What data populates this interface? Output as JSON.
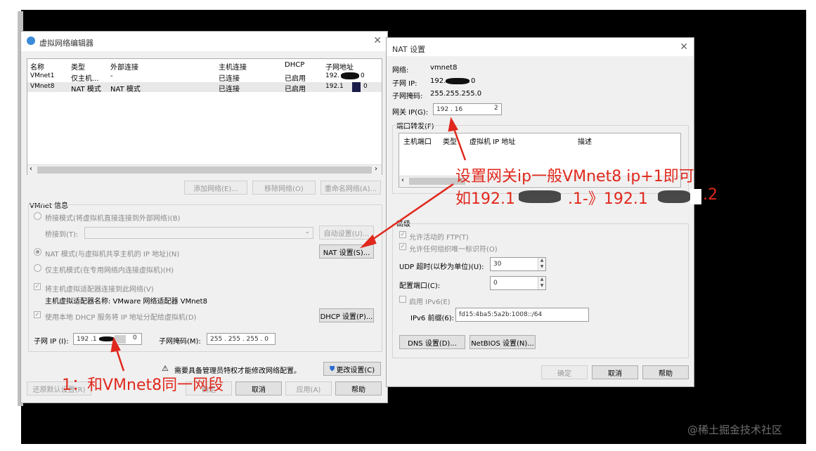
{
  "vne": {
    "title": "虚拟网络编辑器",
    "columns": [
      "名称",
      "类型",
      "外部连接",
      "主机连接",
      "DHCP",
      "子网地址"
    ],
    "rows": [
      {
        "name": "VMnet1",
        "type": "仅主机...",
        "ext": "-",
        "host": "已连接",
        "dhcp": "已启用",
        "subnet": "192."
      },
      {
        "name": "VMnet8",
        "type": "NAT 模式",
        "ext": "NAT 模式",
        "host": "已连接",
        "dhcp": "已启用",
        "subnet": "192.1"
      }
    ],
    "subnet_suffix_1": "0",
    "subnet_suffix_2": "0",
    "add_network": "添加网络(E)...",
    "remove_network": "移除网络(O)",
    "rename_network": "重命名网络(A)...",
    "info_label": "VMnet 信息",
    "bridge_mode": "桥接模式(将虚拟机直接连接到外部网络)(B)",
    "bridge_to": "桥接到(T):",
    "auto_settings": "自动设置(U)...",
    "nat_mode": "NAT 模式(与虚拟机共享主机的 IP 地址)(N)",
    "nat_settings": "NAT 设置(S)...",
    "host_only": "仅主机模式(在专用网络内连接虚拟机)(H)",
    "connect_adapter": "将主机虚拟适配器连接到此网络(V)",
    "adapter_name": "主机虚拟适配器名称: VMware 网络适配器 VMnet8",
    "use_dhcp": "使用本地 DHCP 服务将 IP 地址分配给虚拟机(D)",
    "dhcp_settings": "DHCP 设置(P)...",
    "subnet_ip_label": "子网 IP (I):",
    "subnet_ip_value": "192 .1",
    "subnet_ip_end": "0",
    "subnet_mask_label": "子网掩码(M):",
    "subnet_mask_value": "255 . 255 . 255 . 0",
    "admin_warning": "需要具备管理员特权才能修改网络配置。",
    "change_settings": "更改设置(C)",
    "restore_defaults": "还原默认设置(R)",
    "ok": "确定",
    "cancel": "取消",
    "apply": "应用(A)",
    "help": "帮助"
  },
  "nat": {
    "title": "NAT 设置",
    "network_label": "网络:",
    "network_value": "vmnet8",
    "subnet_ip_label": "子网 IP:",
    "subnet_ip_value": "192.",
    "subnet_ip_end": "0",
    "subnet_mask_label": "子网掩码:",
    "subnet_mask_value": "255.255.255.0",
    "gateway_label": "网关 IP(G):",
    "gateway_value": "192 . 16",
    "gateway_end": "2",
    "port_forward_label": "端口转发(F)",
    "pf_columns": [
      "主机端口",
      "类型",
      "虚拟机 IP 地址",
      "描述"
    ],
    "advanced_label": "高级",
    "allow_ftp": "允许活动的 FTP(T)",
    "allow_any_oui": "允许任何组织唯一标识符(O)",
    "udp_timeout_label": "UDP 超时(以秒为单位)(U):",
    "udp_timeout_value": "30",
    "config_port_label": "配置端口(C):",
    "config_port_value": "0",
    "enable_ipv6": "启用 IPv6(E)",
    "ipv6_prefix_label": "IPv6 前缀(6):",
    "ipv6_prefix_value": "fd15:4ba5:5a2b:1008::/64",
    "dns_settings": "DNS 设置(D)...",
    "netbios_settings": "NetBIOS 设置(N)...",
    "ok": "确定",
    "cancel": "取消",
    "help": "帮助"
  },
  "annotations": {
    "note1": "设置网关ip一般VMnet8 ip+1即可",
    "note2_a": "如192.1",
    "note2_b": ".1-》192.1",
    "note2_c": ".2",
    "note3": "1：和VMnet8同一网段"
  },
  "watermark": "@稀土掘金技术社区",
  "colors": {
    "annotation": "#e0281c",
    "background": "#000000",
    "dialog": "#f0f0f0"
  }
}
